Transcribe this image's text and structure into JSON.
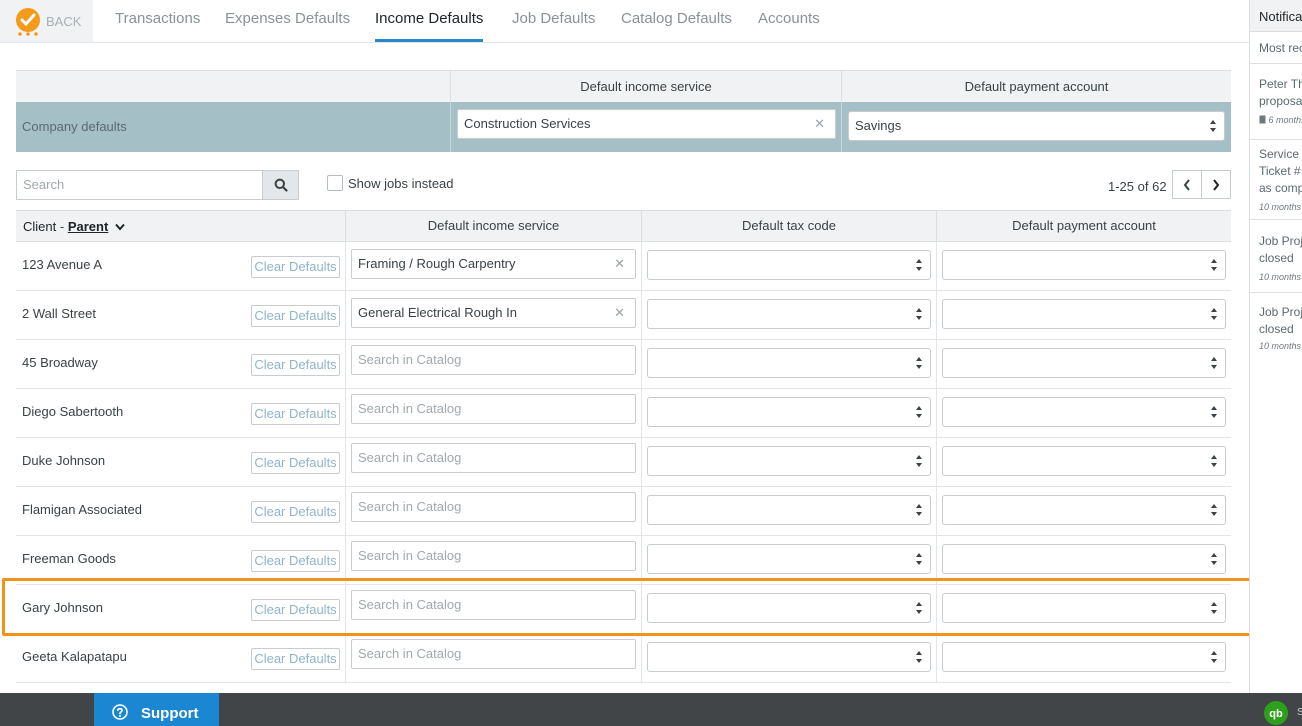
{
  "nav": {
    "back_label": "BACK",
    "tabs": [
      {
        "label": "Transactions"
      },
      {
        "label": "Expenses Defaults"
      },
      {
        "label": "Income Defaults"
      },
      {
        "label": "Job Defaults"
      },
      {
        "label": "Catalog Defaults"
      },
      {
        "label": "Accounts"
      }
    ],
    "active_tab": "Income Defaults"
  },
  "company": {
    "col_income": "Default income service",
    "col_payment": "Default payment account",
    "row_label": "Company defaults",
    "income_value": "Construction Services",
    "payment_value": "Savings"
  },
  "toolbar": {
    "search_placeholder": "Search",
    "show_jobs_label": "Show jobs instead",
    "show_jobs_checked": false,
    "pager_text": "1-25 of 62"
  },
  "table": {
    "client_label": "Client",
    "sep": " - ",
    "parent_label": "Parent",
    "col_income": "Default income service",
    "col_tax": "Default tax code",
    "col_payment": "Default payment account",
    "clear_label": "Clear Defaults",
    "placeholder": "Search in Catalog",
    "rows": [
      {
        "client": "123 Avenue A",
        "income": "Framing / Rough Carpentry"
      },
      {
        "client": "2 Wall Street",
        "income": "General Electrical Rough In"
      },
      {
        "client": "45 Broadway",
        "income": ""
      },
      {
        "client": "Diego Sabertooth",
        "income": ""
      },
      {
        "client": "Duke Johnson",
        "income": ""
      },
      {
        "client": "Flamigan Associated",
        "income": ""
      },
      {
        "client": "Freeman Goods",
        "income": ""
      },
      {
        "client": "Gary Johnson",
        "income": "",
        "highlighted": true
      },
      {
        "client": "Geeta Kalapatapu",
        "income": ""
      }
    ]
  },
  "notifications": {
    "title": "Notifica",
    "subtitle": "Most rec",
    "items": [
      {
        "lines": [
          "Peter Th",
          "proposa"
        ],
        "time": "6 months"
      },
      {
        "lines": [
          "Service",
          "Ticket #",
          "as comp"
        ],
        "time": "10 months"
      },
      {
        "lines": [
          "Job Proj",
          "closed"
        ],
        "time": "10 months"
      },
      {
        "lines": [
          "Job Proj",
          "closed"
        ],
        "time": "10 months"
      }
    ]
  },
  "bottom": {
    "support_label": "Support",
    "qb_text": "S"
  },
  "colors": {
    "accent": "#2b87c8",
    "company_row": "#a4bfc6",
    "highlight": "#f0921b",
    "support": "#1b86d1",
    "logo": "#f49b1c"
  }
}
